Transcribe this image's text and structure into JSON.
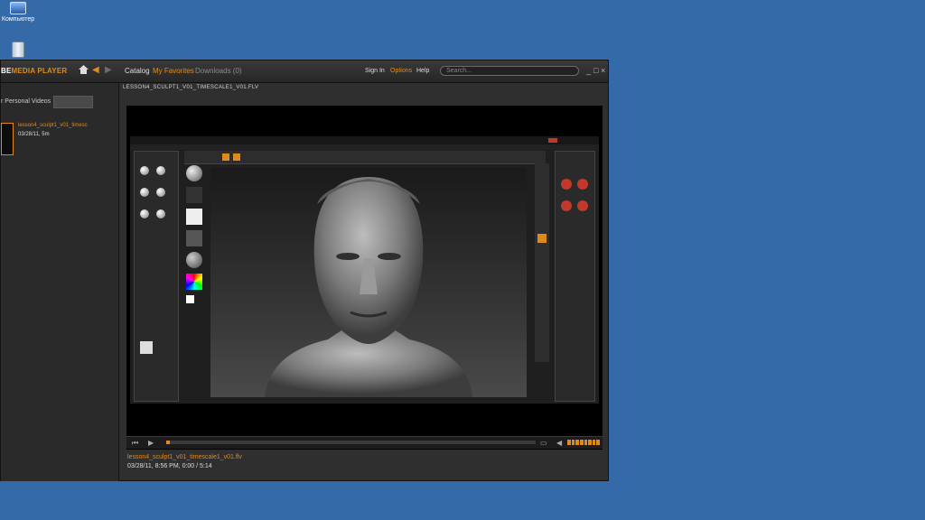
{
  "desktop": {
    "computer_label": "Компьютер"
  },
  "player": {
    "brand_prefix": "BE",
    "brand_main": "MEDIA PLAYER",
    "tabs": [
      "Catalog",
      "My Favorites",
      "Downloads (0)"
    ],
    "links": {
      "signin": "Sign In",
      "options": "Options",
      "help": "Help"
    },
    "search_placeholder": "Search...",
    "window_controls": [
      "_",
      "□",
      "×"
    ],
    "sidebar": {
      "personal_videos_label": "r Personal Videos",
      "item_title": "lesson4_sculpt1_v01_timesc",
      "item_meta": "03/28/11, 5m"
    },
    "filename": "LESSON4_SCULPT1_V01_TIMESCALE1_V01.FLV",
    "status": {
      "title": "lesson4_sculpt1_v01_timescale1_v01.flv",
      "meta": "03/28/11, 8:56 PM,  0:00 / 5:14"
    },
    "playback_progress": 0.01
  },
  "colors": {
    "accent": "#e08a1e",
    "desktop": "#346aa8"
  }
}
